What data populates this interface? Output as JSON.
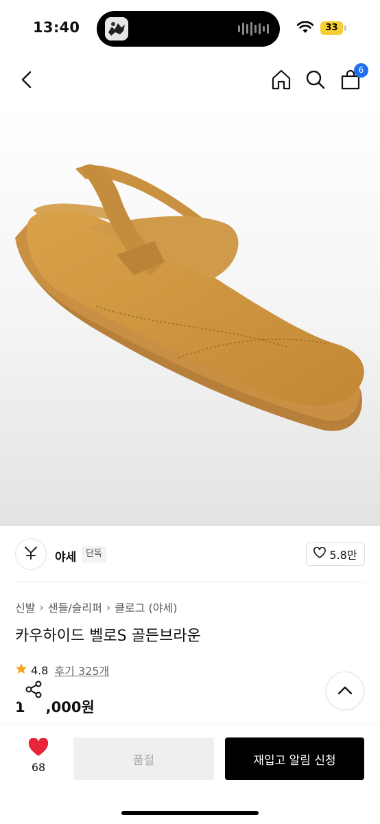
{
  "status_bar": {
    "time": "13:40",
    "battery": "33",
    "icons": [
      "wifi-icon",
      "battery-icon",
      "audio-wave-icon"
    ]
  },
  "nav": {
    "icons": [
      "back-arrow-icon",
      "home-icon",
      "search-icon",
      "cart-icon"
    ],
    "cart_count": "6"
  },
  "product_image": {
    "alt_icon": "clog-shoe-image",
    "colors": {
      "suede": "#c9933f",
      "sole": "#b8843a"
    }
  },
  "brand": {
    "name": "야세",
    "tag": "단독",
    "likes": "5.8만"
  },
  "breadcrumb": [
    "신발",
    "샌들/슬리퍼",
    "클로그 (야세)"
  ],
  "product": {
    "title": "카우하이드 벨로S 골든브라운",
    "rating": "4.8",
    "reviews": "후기 325개",
    "price": "1",
    "price_tail": ",000원"
  },
  "bottom_bar": {
    "wish_count": "68",
    "soldout_label": "품절",
    "restock_label": "재입고 알림 신청"
  },
  "colors": {
    "accent_blue": "#1f6ff0",
    "heart_red": "#e8243b",
    "star": "#f5a623"
  }
}
